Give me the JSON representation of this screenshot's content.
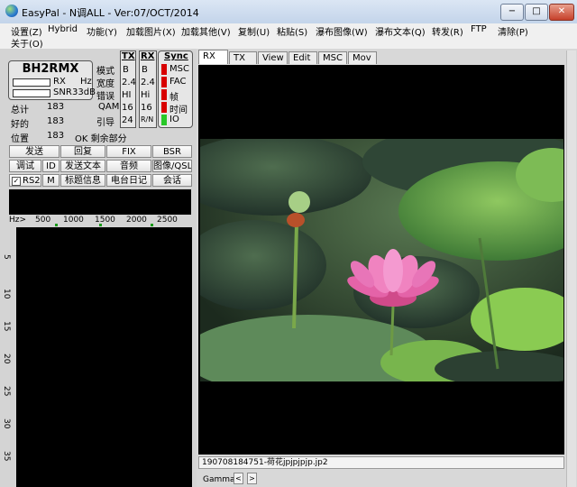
{
  "window": {
    "title": "EasyPal - N调ALL - Ver:07/OCT/2014",
    "minimize": "−",
    "maximize": "□",
    "close": "✕"
  },
  "menu": [
    "设置(Z)",
    "Hybrid",
    "功能(Y)",
    "加载图片(X)",
    "加载其他(V)",
    "复制(U)",
    "粘贴(S)",
    "瀑布图像(W)",
    "瀑布文本(Q)",
    "转发(R)",
    "FTP",
    "清除(P)",
    "关于(O)"
  ],
  "station": {
    "callsign": "BH2RMX",
    "rx_label": "RX",
    "hz_label": "Hz",
    "snr_label": "SNR",
    "snr_value": "33dB",
    "total_label": "总计",
    "total_value": "183",
    "good_label": "好的",
    "good_value": "183",
    "pos_label": "位置",
    "pos_value": "183",
    "ok_text": "OK 剩余部分"
  },
  "params": {
    "labels": [
      "模式",
      "宽度",
      "错误",
      "QAM",
      "引导"
    ],
    "tx_head": "TX",
    "tx": [
      "B",
      "2.4",
      "HI",
      "16",
      "24"
    ],
    "rx_head": "RX",
    "rx": [
      "B",
      "2.4",
      "Hi",
      "16",
      "R/N"
    ]
  },
  "sync": {
    "head": "Sync",
    "items": [
      "MSC",
      "FAC",
      "帧",
      "时间",
      "IO"
    ]
  },
  "buttons": {
    "row1": [
      "发送",
      "回复",
      "FIX",
      "BSR"
    ],
    "row2": [
      "调试",
      "ID",
      "发送文本",
      "音频",
      "图像/QSL"
    ],
    "row3": [
      "RS2",
      "M",
      "标题信息",
      "电台日记",
      "会话"
    ],
    "rs2_checked": true
  },
  "freq_axis": [
    "Hz>",
    "500",
    "1000",
    "1500",
    "2000",
    "2500"
  ],
  "waterfall_ticks": [
    "5",
    "10",
    "15",
    "20",
    "25",
    "30",
    "35"
  ],
  "tabs": [
    "RX",
    "TX",
    "View",
    "Edit",
    "MSC",
    "Mov"
  ],
  "active_tab": "RX",
  "filename": "190708184751-荷花jpjpjpjp.jp2",
  "gamma_label": "Gamma",
  "gamma_minus": "<",
  "gamma_plus": ">",
  "colors": {
    "sync_red": "#d80000",
    "sync_green": "#28c828",
    "panel": "#d4d4d4"
  }
}
